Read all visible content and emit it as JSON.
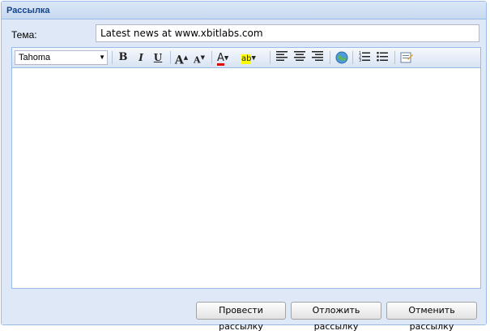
{
  "panel": {
    "title": "Рассылка"
  },
  "form": {
    "subject_label": "Тема:",
    "subject_value": "Latest news at www.xbitlabs.com"
  },
  "editor": {
    "font_family": "Tahoma",
    "toolbar": {
      "bold": "B",
      "italic": "I",
      "underline": "U",
      "grow": "A",
      "shrink": "A",
      "font_color": "A",
      "highlight": "ab"
    },
    "colors": {
      "font_color_bar": "#e00000",
      "highlight_bar": "#ffff00"
    }
  },
  "buttons": {
    "send": "Провести рассылку",
    "postpone": "Отложить рассылку",
    "cancel": "Отменить рассылку"
  }
}
